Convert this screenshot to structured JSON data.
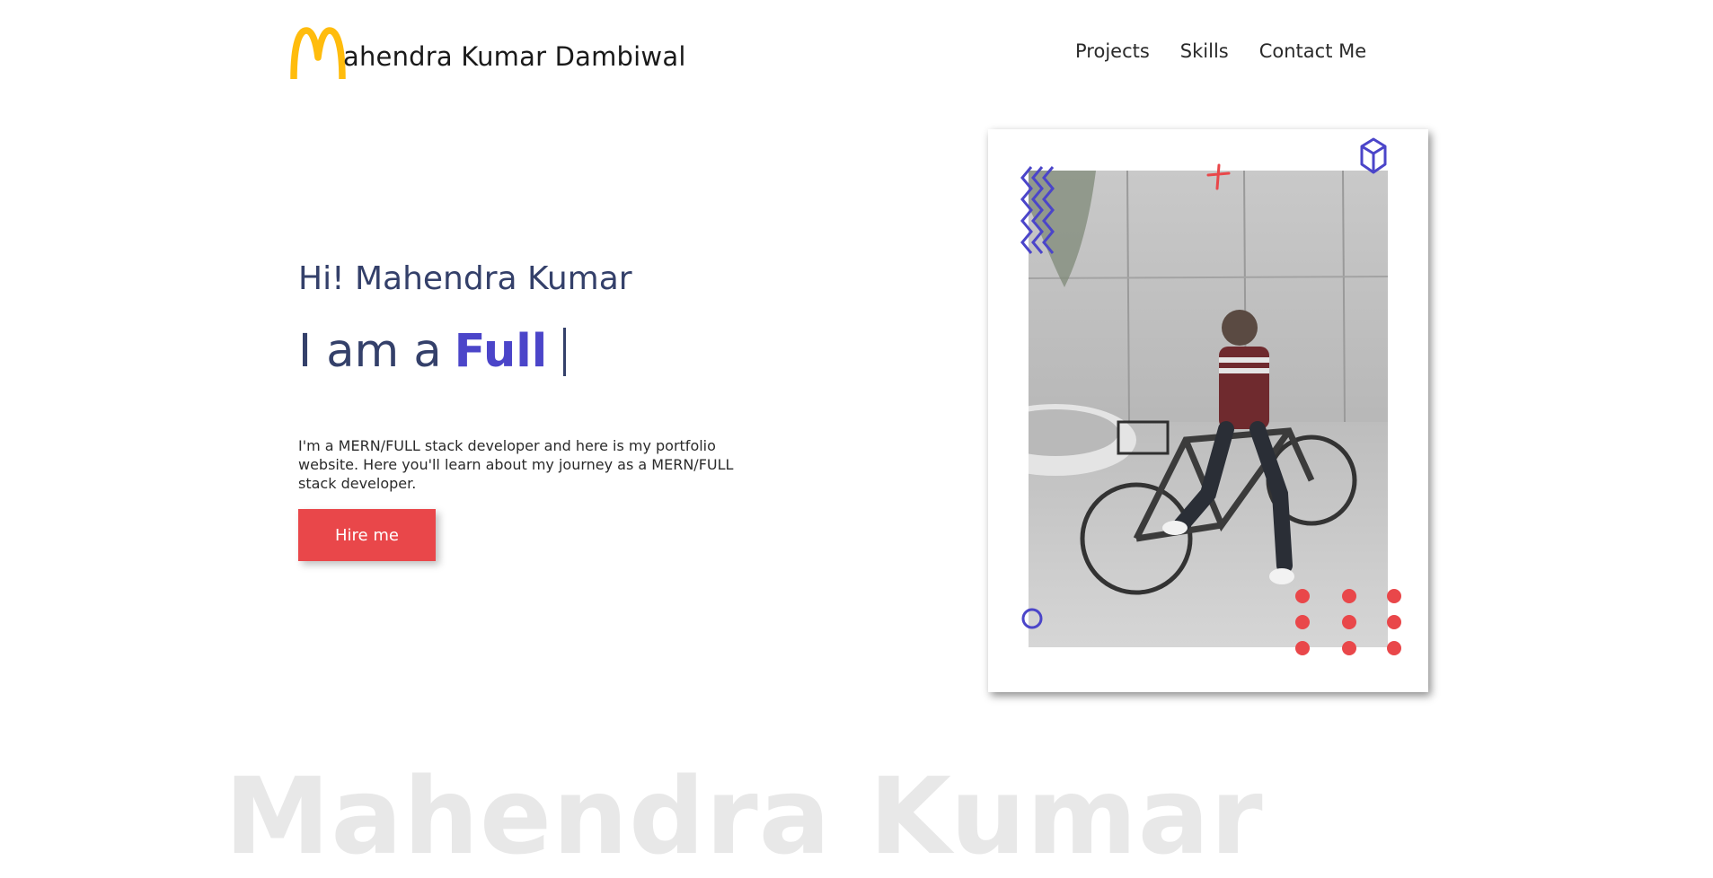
{
  "header": {
    "brand_text": "ahendra Kumar Dambiwal",
    "logo_icon": "golden-arches-m-icon",
    "nav": [
      {
        "label": "Projects"
      },
      {
        "label": "Skills"
      },
      {
        "label": "Contact Me"
      }
    ]
  },
  "hero": {
    "greeting": "Hi! Mahendra Kumar",
    "role_prefix": "I am a",
    "role_typed": "Full",
    "intro": "I'm a MERN/FULL stack developer and here is my portfolio website. Here you'll learn about my journey as a MERN/FULL stack developer.",
    "hire_label": "Hire me"
  },
  "background_name": "Mahendra Kumar",
  "colors": {
    "accent_purple": "#4b45c9",
    "accent_red": "#e9474a",
    "logo_yellow": "#ffbc0d",
    "heading_navy": "#34406a"
  }
}
